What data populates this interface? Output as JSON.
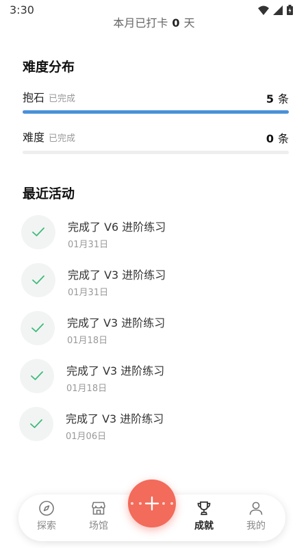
{
  "status_bar": {
    "time": "3:30"
  },
  "checkin": {
    "prefix": "本月已打卡",
    "count": "0",
    "suffix": "天"
  },
  "difficulty": {
    "title": "难度分布",
    "rows": [
      {
        "label": "抱石",
        "sub": "已完成",
        "count": "5",
        "unit": "条",
        "fill_fraction": 1.0
      },
      {
        "label": "难度",
        "sub": "已完成",
        "count": "0",
        "unit": "条",
        "fill_fraction": 0.0
      }
    ]
  },
  "recent": {
    "title": "最近活动",
    "items": [
      {
        "title": "完成了 V6 进阶练习",
        "date": "01月31日",
        "icon": "check-icon"
      },
      {
        "title": "完成了 V3 进阶练习",
        "date": "01月31日",
        "icon": "check-icon"
      },
      {
        "title": "完成了 V3 进阶练习",
        "date": "01月18日",
        "icon": "check-icon"
      },
      {
        "title": "完成了 V3 进阶练习",
        "date": "01月18日",
        "icon": "check-icon"
      },
      {
        "title": "完成了 V3 进阶练习",
        "date": "01月06日",
        "icon": "check-icon"
      }
    ]
  },
  "nav": {
    "items": [
      {
        "label": "探索",
        "icon": "compass-icon"
      },
      {
        "label": "场馆",
        "icon": "store-icon"
      },
      {
        "label": "成就",
        "icon": "trophy-icon",
        "active": true
      },
      {
        "label": "我的",
        "icon": "user-icon"
      }
    ],
    "fab_icon": "plus-icon"
  },
  "colors": {
    "accent_blue": "#4a90d9",
    "fab_red": "#f26b5b",
    "check_green": "#3dba7a"
  }
}
